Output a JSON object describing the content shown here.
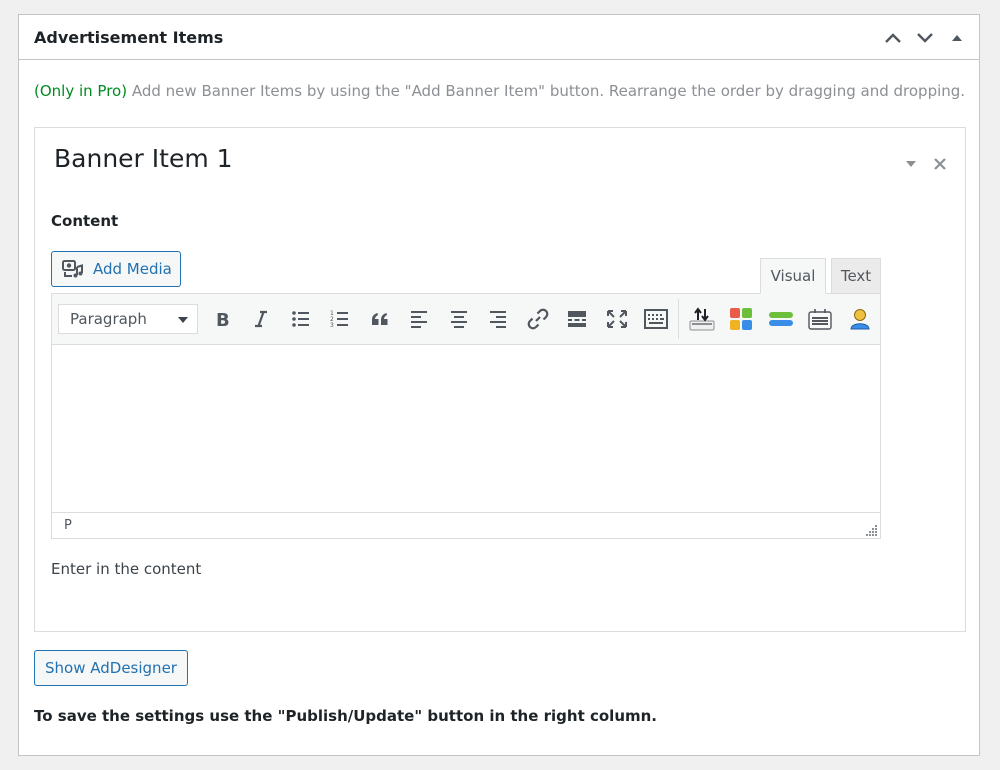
{
  "metabox": {
    "title": "Advertisement Items",
    "controls": [
      "move-up",
      "move-down",
      "toggle"
    ]
  },
  "intro": {
    "pro_tag": "(Only in Pro)",
    "text": "Add new Banner Items by using the \"Add Banner Item\" button. Rearrange the order by dragging and dropping."
  },
  "banner_item": {
    "title": "Banner Item 1",
    "content_label": "Content",
    "add_media_label": "Add Media",
    "tabs": {
      "visual": "Visual",
      "text": "Text",
      "active": "visual"
    },
    "format_select": {
      "value": "Paragraph"
    },
    "toolbar_icons": [
      "bold-icon",
      "italic-icon",
      "bullet-list-icon",
      "numbered-list-icon",
      "blockquote-icon",
      "align-left-icon",
      "align-center-icon",
      "align-right-icon",
      "link-icon",
      "read-more-icon",
      "fullscreen-icon",
      "toolbar-toggle-icon",
      "import-icon",
      "shortcode-grid-icon",
      "layers-icon",
      "table-icon",
      "user-icon"
    ],
    "status_path": "P",
    "description": "Enter in the content"
  },
  "actions": {
    "show_addesigner_label": "Show AdDesigner"
  },
  "footer_note": "To save the settings use the \"Publish/Update\" button in the right column.",
  "colors": {
    "accent": "#2271b1",
    "pro_green": "#008a20",
    "muted": "#8c8f94"
  }
}
